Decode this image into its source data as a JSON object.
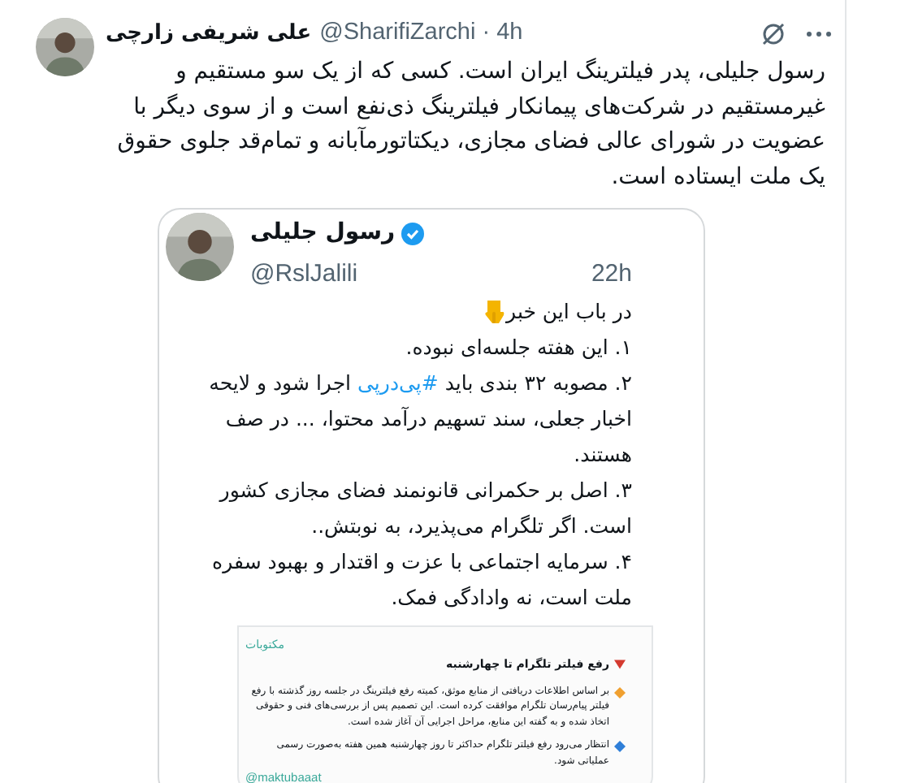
{
  "tweet": {
    "name": "علی شریفی زارچی",
    "handle": "@SharifiZarchi · 4h",
    "text": "رسول جلیلی، پدر فیلترینگ ایران است. کسی که از یک سو مستقیم و غیرمستقیم در شرکت‌های پیمانکار فیلترینگ ذی‌نفع است و از سوی دیگر با عضویت در شورای عالی فضای مجازی، دیکتاتورمآبانه و تمام‌قد جلوی حقوق یک ملت ایستاده است."
  },
  "quoted": {
    "name": "رسول جلیلی",
    "verified": true,
    "handle": "@RslJalili",
    "time": "22h",
    "paragraphs": [
      {
        "kind": "intro",
        "text": "در باب این خبر"
      },
      {
        "kind": "plain",
        "text": "۱. این هفته جلسه‌ای نبوده."
      },
      {
        "kind": "hashtag",
        "before": "۲. مصوبه ۳۲ بندی باید",
        "tag": "#پی‌درپی",
        "after": "اجرا شود و لایحه اخبار جعلی، سند تسهیم درآمد محتوا، ... در صف هستند."
      },
      {
        "kind": "plain",
        "text": "۳. اصل بر حکمرانی قانونمند فضای مجازی کشور است. اگر تلگرام می‌پذیرد، به نوبتش.."
      },
      {
        "kind": "plain",
        "text": "۴. سرمایه اجتماعی با عزت و اقتدار و بهبود سفره ملت است، نه واداد‌گی فمک."
      }
    ],
    "document": {
      "source": "مکتوبات",
      "title": "رفع فیلتر تلگرام تا چهارشنبه",
      "items": [
        {
          "kind": "orange",
          "text": "بر اساس اطلاعات دریافتی از منابع موثق، کمیته رفع فیلترینگ در جلسه روز گذشته با رفع فیلتر پیام‌رسان تلگرام موافقت کرده است. این تصمیم پس از بررسی‌های فنی و حقوقی اتخاذ شده و به گفته این منابع، مراحل اجرایی آن آغاز شده است."
        },
        {
          "kind": "blue",
          "text": "انتظار می‌رود رفع فیلتر تلگرام حداکثر تا روز چهارشنبه همین هفته به‌صورت رسمی عملیاتی شود."
        }
      ],
      "footer": "@maktubaaat"
    }
  }
}
